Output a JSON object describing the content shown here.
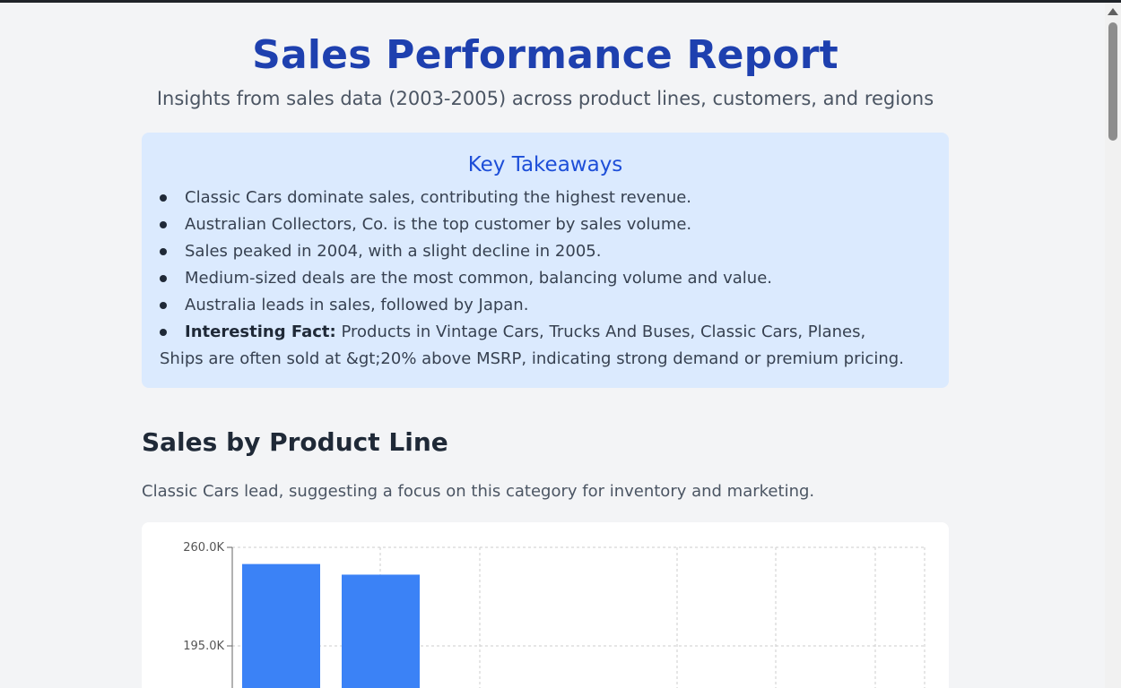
{
  "report": {
    "title": "Sales Performance Report",
    "subtitle": "Insights from sales data (2003-2005) across product lines, customers, and regions"
  },
  "takeaways": {
    "heading": "Key Takeaways",
    "items": [
      "Classic Cars dominate sales, contributing the highest revenue.",
      "Australian Collectors, Co. is the top customer by sales volume.",
      "Sales peaked in 2004, with a slight decline in 2005.",
      "Medium-sized deals are the most common, balancing volume and value.",
      "Australia leads in sales, followed by Japan."
    ],
    "fact_label": "Interesting Fact:",
    "fact_text": " Products in Vintage Cars, Trucks And Buses, Classic Cars, Planes, Ships are often sold at &gt;20% above MSRP, indicating strong demand or premium pricing."
  },
  "section": {
    "title": "Sales by Product Line",
    "description": "Classic Cars lead, suggesting a focus on this category for inventory and marketing."
  },
  "colors": {
    "accent": "#1e40af",
    "bar": "#3b82f6",
    "takeaway_bg": "#dbeafe"
  },
  "chart_data": {
    "type": "bar",
    "y_ticks": [
      "260.0K",
      "195.0K"
    ],
    "ylim_visible": [
      195000,
      260000
    ],
    "values": [
      249000,
      242000
    ],
    "grid": true
  }
}
